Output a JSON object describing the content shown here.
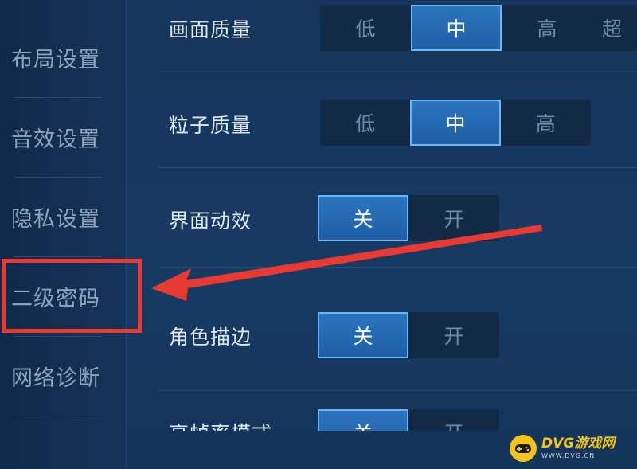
{
  "sidebar": {
    "items": [
      {
        "label": "布局设置"
      },
      {
        "label": "音效设置"
      },
      {
        "label": "隐私设置"
      },
      {
        "label": "二级密码"
      },
      {
        "label": "网络诊断"
      }
    ]
  },
  "settings": {
    "graphics_quality": {
      "label": "画面质量",
      "options": [
        "低",
        "中",
        "高",
        "超"
      ],
      "selected": "中"
    },
    "particle_quality": {
      "label": "粒子质量",
      "options": [
        "低",
        "中",
        "高"
      ],
      "selected": "中"
    },
    "ui_effects": {
      "label": "界面动效",
      "options": [
        "关",
        "开"
      ],
      "selected": "关"
    },
    "character_outline": {
      "label": "角色描边",
      "options": [
        "关",
        "开"
      ],
      "selected": "关"
    },
    "high_fps_mode": {
      "label": "高帧率模式",
      "options": [
        "关",
        "开"
      ],
      "selected": "关"
    }
  },
  "watermark": {
    "title": "DVG游戏网",
    "subtitle": "WWW.DVG.CN"
  },
  "colors": {
    "accent": "#2c74bf",
    "highlight": "#e63a32",
    "watermark": "#f4c21a"
  }
}
